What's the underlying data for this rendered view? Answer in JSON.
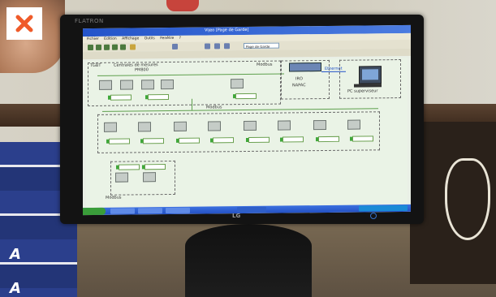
{
  "photo": {
    "monitor_brand": "FLATRON",
    "monitor_logo": "LG"
  },
  "window": {
    "title": "Vijeo [Page de Garde]",
    "page_select": "Page de Garde"
  },
  "menu": [
    "Fichier",
    "Edition",
    "Affichage",
    "Outils",
    "Fenêtre",
    "?"
  ],
  "diagram": {
    "tgbt_label": "TGBT",
    "centrales_label": "Centrales de mesures",
    "pm_label": "PM800",
    "modbus_top": "Modbus",
    "modbus_mid": "Modbus",
    "modbus_bottom": "Modbus",
    "iro_label": "IRO",
    "napac_label": "NAPAC",
    "pc_label": "PC superviseur",
    "ethernet_label": "Ethernet"
  },
  "colors": {
    "screen_bg": "#eaf3e6",
    "titlebar": "#2454c9",
    "bus": "#5ea04d",
    "close_x": "#ef5b2a"
  },
  "icons": [
    "close-icon"
  ]
}
